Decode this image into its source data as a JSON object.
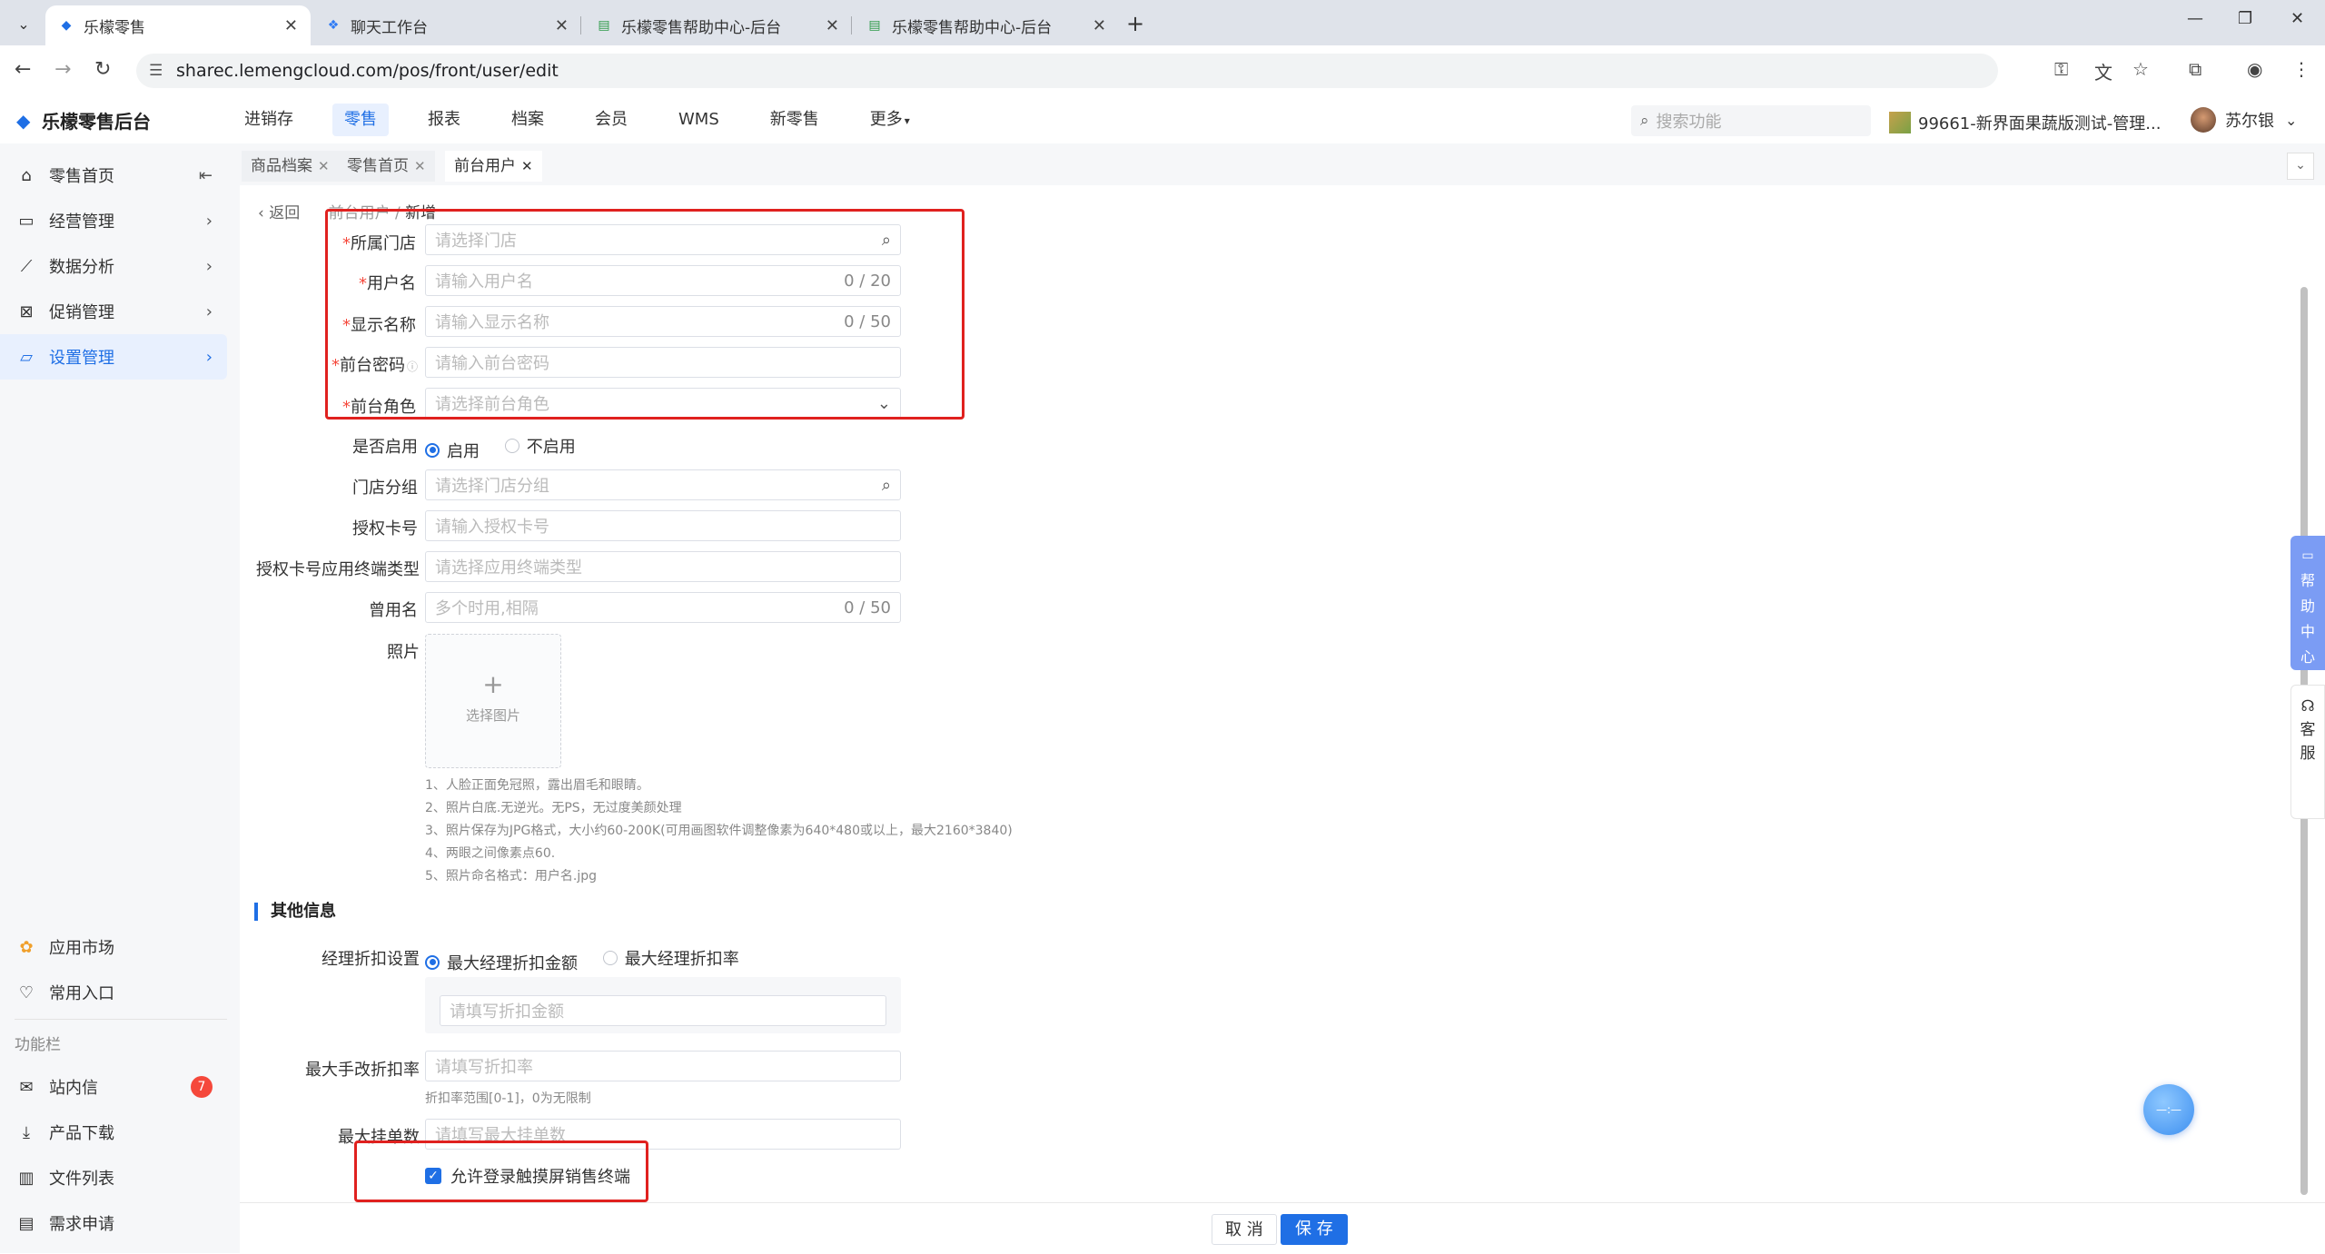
{
  "browser": {
    "tabs": [
      {
        "title": "乐檬零售",
        "active": true
      },
      {
        "title": "聊天工作台",
        "active": false
      },
      {
        "title": "乐檬零售帮助中心-后台",
        "active": false
      },
      {
        "title": "乐檬零售帮助中心-后台",
        "active": false
      }
    ],
    "url": "sharec.lemengcloud.com/pos/front/user/edit"
  },
  "header": {
    "logo": "乐檬零售后台",
    "nav": [
      "进销存",
      "零售",
      "报表",
      "档案",
      "会员",
      "WMS",
      "新零售",
      "更多"
    ],
    "active_nav": "零售",
    "search_placeholder": "搜索功能",
    "store": "99661-新界面果蔬版测试-管理...",
    "user": "苏尔银"
  },
  "sidebar": {
    "items": [
      {
        "label": "零售首页",
        "icon": "home-icon"
      },
      {
        "label": "经营管理",
        "icon": "chart-board-icon"
      },
      {
        "label": "数据分析",
        "icon": "line-chart-icon"
      },
      {
        "label": "促销管理",
        "icon": "promo-icon"
      },
      {
        "label": "设置管理",
        "icon": "folder-icon"
      }
    ],
    "bottom": [
      {
        "label": "应用市场",
        "icon": "app-market-icon"
      },
      {
        "label": "常用入口",
        "icon": "heart-icon"
      }
    ],
    "group_label": "功能栏",
    "tools": [
      {
        "label": "站内信",
        "icon": "mail-icon",
        "badge": "7"
      },
      {
        "label": "产品下载",
        "icon": "download-icon"
      },
      {
        "label": "文件列表",
        "icon": "file-list-icon"
      },
      {
        "label": "需求申请",
        "icon": "request-icon"
      }
    ]
  },
  "page_tabs": [
    "商品档案",
    "零售首页",
    "前台用户"
  ],
  "breadcrumb": {
    "back": "返回",
    "parent": "前台用户",
    "current": "新增"
  },
  "form": {
    "store": {
      "label": "所属门店",
      "placeholder": "请选择门店"
    },
    "username": {
      "label": "用户名",
      "placeholder": "请输入用户名",
      "count": "0 / 20"
    },
    "display_name": {
      "label": "显示名称",
      "placeholder": "请输入显示名称",
      "count": "0 / 50"
    },
    "password": {
      "label": "前台密码",
      "placeholder": "请输入前台密码"
    },
    "role": {
      "label": "前台角色",
      "placeholder": "请选择前台角色"
    },
    "enabled": {
      "label": "是否启用",
      "options": [
        "启用",
        "不启用"
      ],
      "selected": "启用"
    },
    "store_group": {
      "label": "门店分组",
      "placeholder": "请选择门店分组"
    },
    "auth_card": {
      "label": "授权卡号",
      "placeholder": "请输入授权卡号"
    },
    "terminal_type": {
      "label": "授权卡号应用终端类型",
      "placeholder": "请选择应用终端类型"
    },
    "former_name": {
      "label": "曾用名",
      "placeholder": "多个时用,相隔",
      "count": "0 / 50"
    },
    "photo": {
      "label": "照片",
      "button": "选择图片"
    },
    "photo_tips": [
      "1、人脸正面免冠照，露出眉毛和眼睛。",
      "2、照片白底.无逆光。无PS，无过度美颜处理",
      "3、照片保存为JPG格式，大小约60-200K(可用画图软件调整像素为640*480或以上，最大2160*3840)",
      "4、两眼之间像素点60.",
      "5、照片命名格式：用户名.jpg"
    ]
  },
  "other": {
    "section_title": "其他信息",
    "discount_setting": {
      "label": "经理折扣设置",
      "options": [
        "最大经理折扣金额",
        "最大经理折扣率"
      ],
      "selected": "最大经理折扣金额"
    },
    "discount_amount_placeholder": "请填写折扣金额",
    "max_manual_discount": {
      "label": "最大手改折扣率",
      "placeholder": "请填写折扣率",
      "hint": "折扣率范围[0-1]，0为无限制"
    },
    "max_hold": {
      "label": "最大挂单数",
      "placeholder": "请填写最大挂单数"
    },
    "touch_terminal": {
      "label": "允许登录触摸屏销售终端",
      "checked": true
    }
  },
  "footer": {
    "cancel": "取 消",
    "save": "保 存"
  },
  "widgets": {
    "help": [
      "帮",
      "助",
      "中",
      "心"
    ],
    "service": [
      "客",
      "服"
    ],
    "float_label": "—:—"
  }
}
